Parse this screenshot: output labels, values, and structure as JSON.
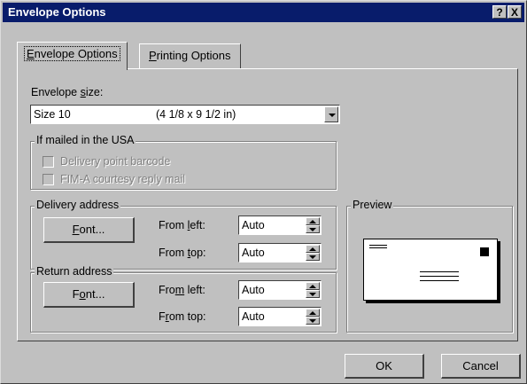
{
  "window": {
    "title": "Envelope Options",
    "help_label": "?",
    "close_label": "X"
  },
  "tabs": [
    {
      "pre": "",
      "key": "E",
      "post": "nvelope Options",
      "active": true
    },
    {
      "pre": "",
      "key": "P",
      "post": "rinting Options",
      "active": false
    }
  ],
  "envelope_size": {
    "label_pre": "Envelope ",
    "label_key": "s",
    "label_post": "ize:",
    "selected_name": "Size 10",
    "selected_dims": "(4 1/8 x 9 1/2 in)"
  },
  "usa_group": {
    "title": "If mailed in the USA",
    "options": [
      {
        "label": "Delivery point barcode",
        "checked": false,
        "enabled": false
      },
      {
        "label": "FIM-A courtesy reply mail",
        "checked": false,
        "enabled": false
      }
    ]
  },
  "delivery": {
    "title": "Delivery address",
    "font_pre": "",
    "font_key": "F",
    "font_post": "ont...",
    "left_pre": "From ",
    "left_key": "l",
    "left_post": "eft:",
    "left_value": "Auto",
    "top_pre": "From ",
    "top_key": "t",
    "top_post": "op:",
    "top_value": "Auto"
  },
  "return": {
    "title": "Return address",
    "font_pre": "F",
    "font_key": "o",
    "font_post": "nt...",
    "left_pre": "Fro",
    "left_key": "m",
    "left_post": " left:",
    "left_value": "Auto",
    "top_pre": "F",
    "top_key": "r",
    "top_post": "om top:",
    "top_value": "Auto"
  },
  "preview": {
    "title": "Preview"
  },
  "buttons": {
    "ok": "OK",
    "cancel": "Cancel"
  }
}
